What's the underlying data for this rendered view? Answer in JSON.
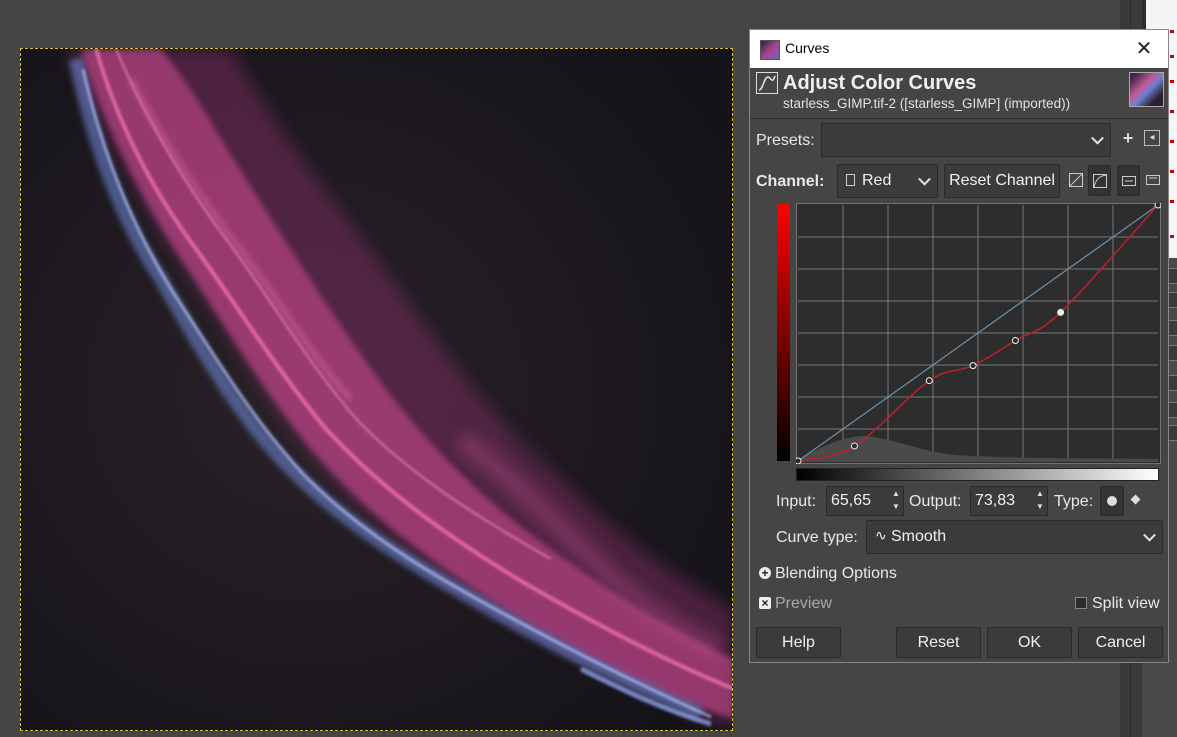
{
  "dialog": {
    "window_title": "Curves",
    "close_glyph": "✕",
    "heading": "Adjust Color Curves",
    "subtitle": "starless_GIMP.tif-2 ([starless_GIMP] (imported))"
  },
  "presets": {
    "label": "Presets:",
    "value": "",
    "add_glyph": "+",
    "menu_glyph": "◂"
  },
  "channel": {
    "label": "Channel:",
    "value": "Red",
    "reset_label": "Reset Channel"
  },
  "curve": {
    "range": [
      0,
      255
    ],
    "points": [
      [
        0,
        0
      ],
      [
        40,
        15
      ],
      [
        93,
        80
      ],
      [
        124,
        95
      ],
      [
        154,
        120
      ],
      [
        186,
        148
      ],
      [
        255,
        255
      ]
    ],
    "curve_color": "#c0202a",
    "diagonal_color": "#6a92b0"
  },
  "readout": {
    "input_label": "Input:",
    "input_value": "65,65",
    "output_label": "Output:",
    "output_value": "73,83",
    "type_label": "Type:"
  },
  "curve_type": {
    "label": "Curve type:",
    "value": "Smooth",
    "glyph": "∿"
  },
  "blending": {
    "label": "Blending Options",
    "glyph": "+"
  },
  "preview": {
    "label": "Preview",
    "glyph": "×"
  },
  "split_view": {
    "label": "Split view"
  },
  "buttons": {
    "help": "Help",
    "reset": "Reset",
    "ok": "OK",
    "cancel": "Cancel"
  },
  "icons": [
    "curves-icon",
    "thumbnail-icon",
    "add-preset-icon",
    "preset-menu-icon",
    "linear-histogram-icon",
    "log-histogram-icon",
    "channel-settings-icon",
    "channel-settings-alt-icon",
    "smooth-point-icon",
    "corner-point-icon"
  ]
}
